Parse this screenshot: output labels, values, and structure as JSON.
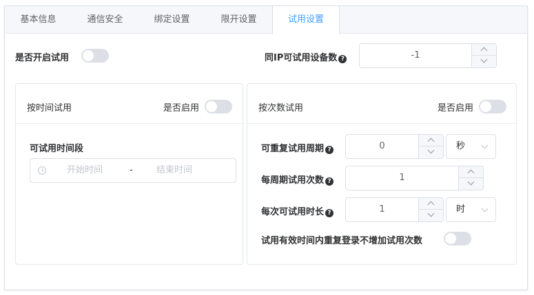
{
  "tabs": [
    {
      "label": "基本信息"
    },
    {
      "label": "通信安全"
    },
    {
      "label": "绑定设置"
    },
    {
      "label": "限开设置"
    },
    {
      "label": "试用设置",
      "active": true
    }
  ],
  "top": {
    "enable_trial_label": "是否开启试用",
    "enable_trial_on": false,
    "ip_devices_label": "同IP可试用设备数",
    "ip_devices_value": "-1"
  },
  "time_card": {
    "title": "按时间试用",
    "enable_label": "是否启用",
    "enabled": false,
    "period_label": "可试用时间段",
    "start_placeholder": "开始时间",
    "separator": "-",
    "end_placeholder": "结束时间"
  },
  "count_card": {
    "title": "按次数试用",
    "enable_label": "是否启用",
    "enabled": false,
    "repeat_cycle_label": "可重复试用周期",
    "repeat_cycle_value": "0",
    "repeat_cycle_unit": "秒",
    "per_cycle_label": "每周期试用次数",
    "per_cycle_value": "1",
    "duration_label": "每次可试用时长",
    "duration_value": "1",
    "duration_unit": "时",
    "relogin_label": "试用有效时间内重复登录不增加试用次数",
    "relogin_on": false
  },
  "icons": {
    "help": "?"
  },
  "colors": {
    "accent": "#409eff",
    "switch_off": "#dcdfe6",
    "border": "#dcdfe6"
  }
}
